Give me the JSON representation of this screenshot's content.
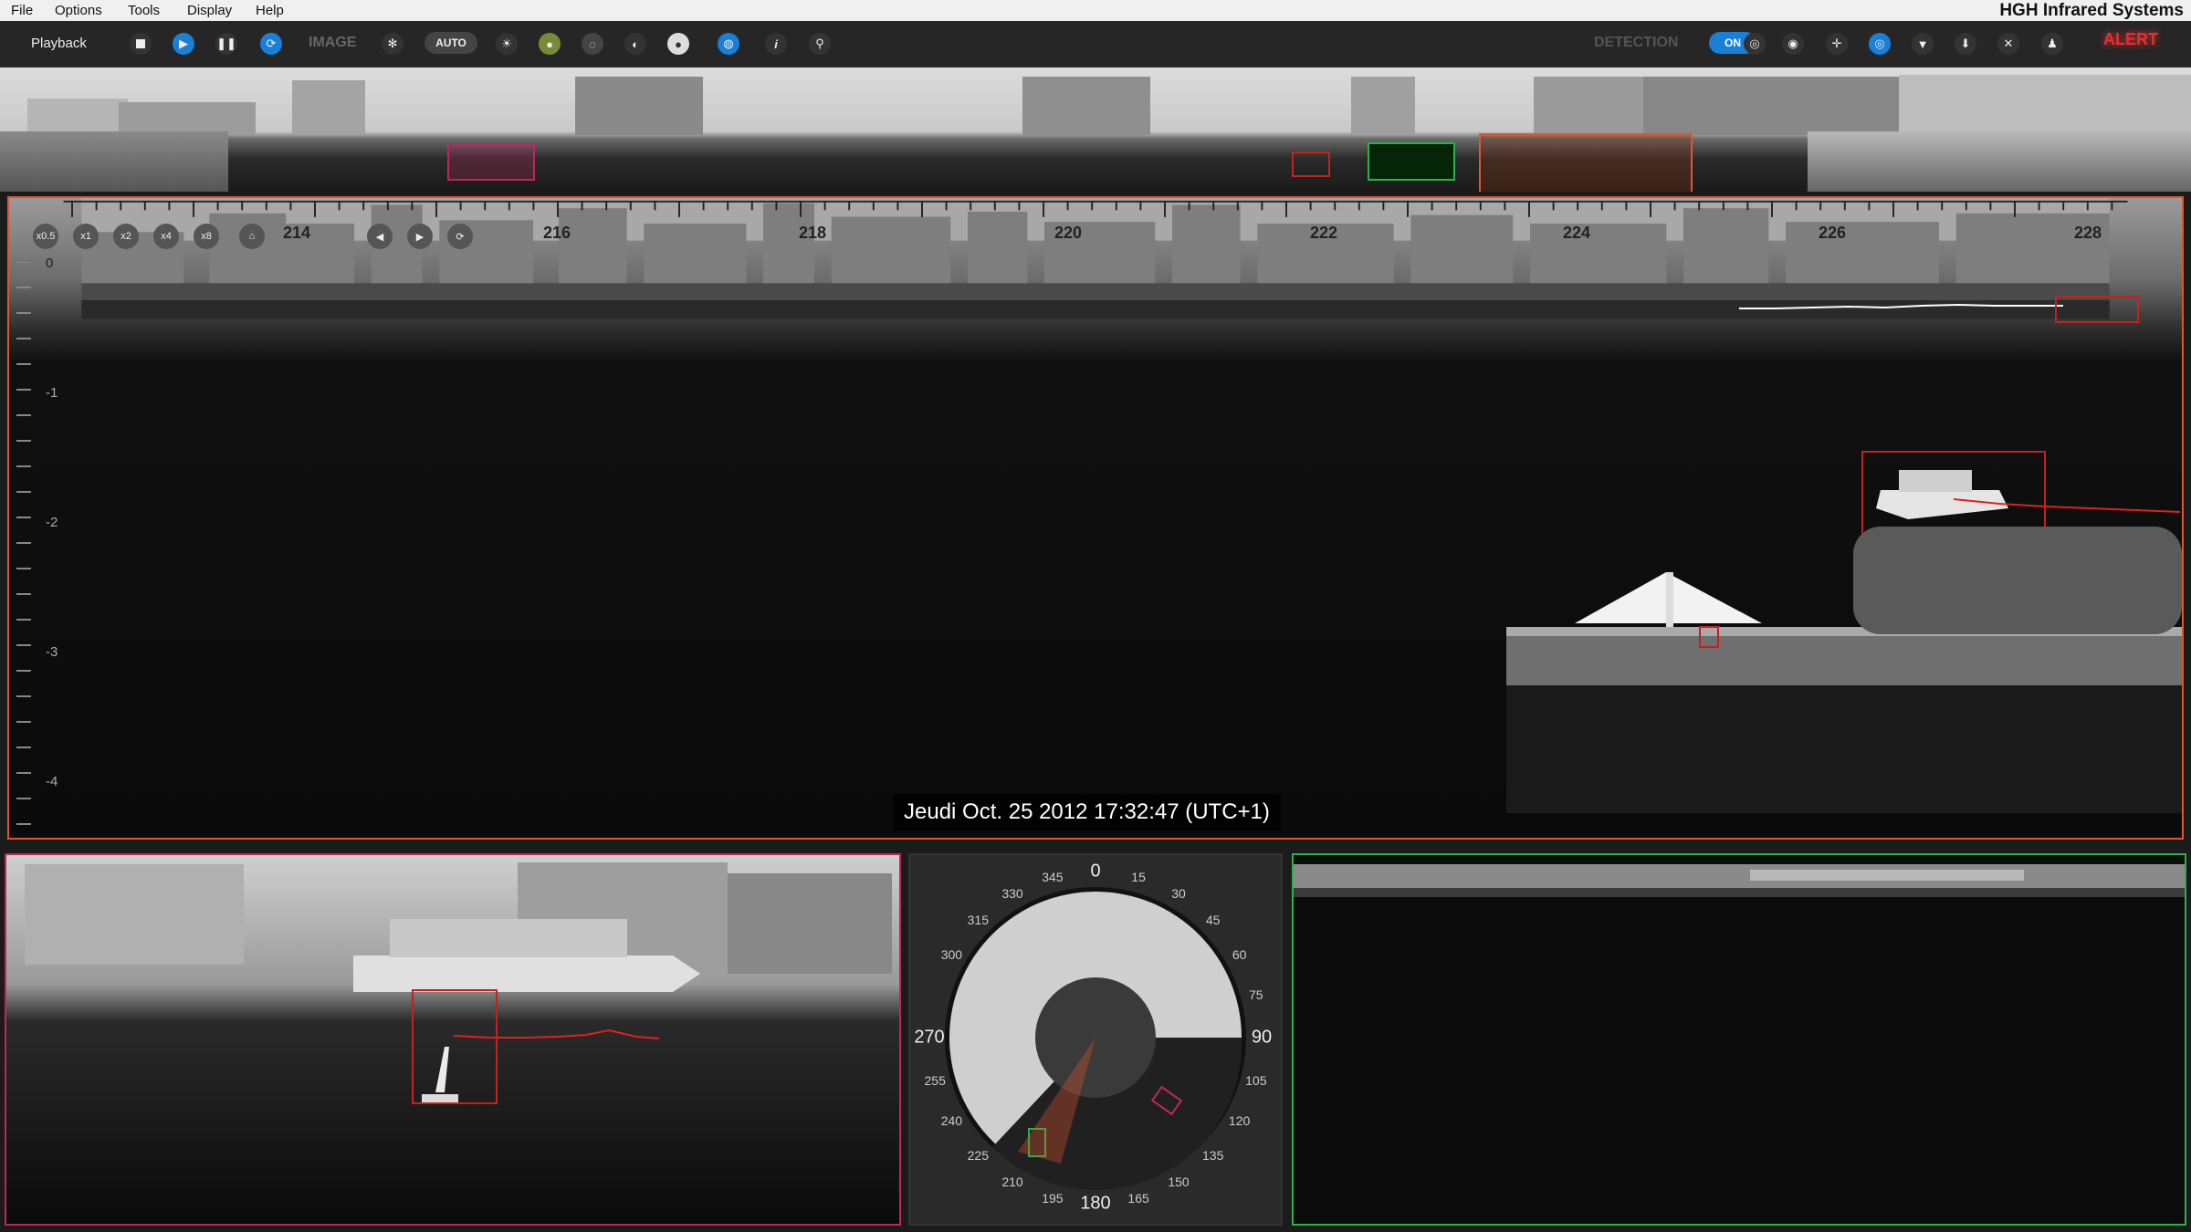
{
  "menubar": {
    "items": [
      "File",
      "Options",
      "Tools",
      "Display",
      "Help"
    ],
    "brand": "HGH Infrared Systems"
  },
  "toolbar": {
    "mode_label": "Playback",
    "image_label": "IMAGE",
    "auto_label": "AUTO",
    "detection_label": "DETECTION",
    "detection_toggle": "ON",
    "alert_label": "ALERT",
    "colors": {
      "accent": "#1a7fd6",
      "alert": "#e53030"
    }
  },
  "main_view": {
    "zoom_buttons": [
      "x0.5",
      "x1",
      "x2",
      "x4",
      "x8"
    ],
    "azimuth_ticks": [
      "214",
      "216",
      "218",
      "220",
      "222",
      "224",
      "226",
      "228"
    ],
    "elevation_ticks": [
      "0",
      "-1",
      "-2",
      "-3",
      "-4"
    ],
    "timestamp": "Jeudi Oct. 25 2012  17:32:47 (UTC+1)",
    "colors": {
      "frame": "#e0552d",
      "track": "#c62020"
    }
  },
  "radar": {
    "bearings": [
      "0",
      "15",
      "30",
      "45",
      "60",
      "75",
      "90",
      "105",
      "120",
      "135",
      "150",
      "165",
      "180",
      "195",
      "210",
      "225",
      "240",
      "255",
      "270",
      "300",
      "315",
      "330",
      "345"
    ]
  },
  "panels": {
    "left_color": "#c0265d",
    "right_color": "#29b24a"
  }
}
